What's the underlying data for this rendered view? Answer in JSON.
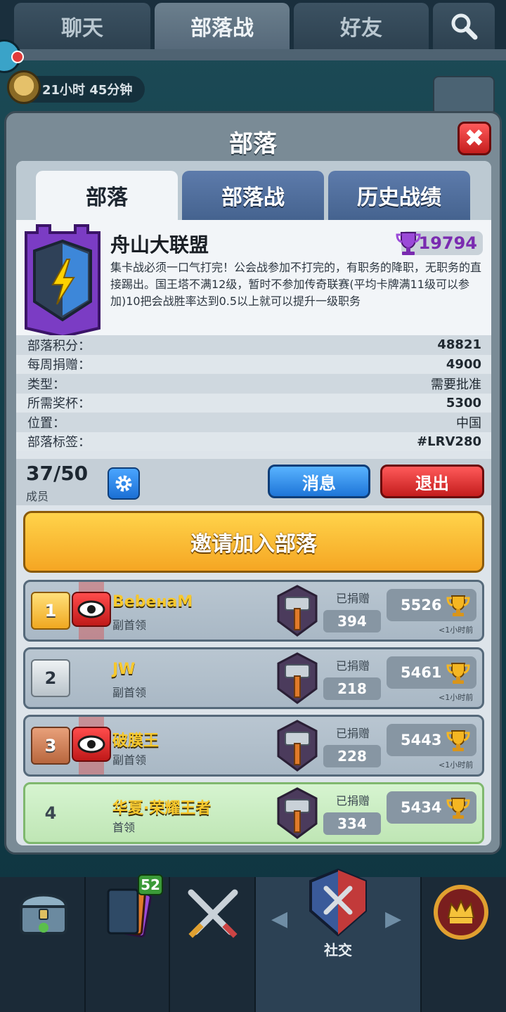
{
  "top_tabs": [
    "聊天",
    "部落战",
    "好友"
  ],
  "timer": {
    "text": "21小时 45分钟"
  },
  "panel": {
    "title": "部落",
    "close_label": "✖"
  },
  "sub_tabs": [
    "部落",
    "部落战",
    "历史战绩"
  ],
  "clan": {
    "name": "舟山大联盟",
    "trophies": "19794",
    "description": "集卡战必须一口气打完！公会战参加不打完的，有职务的降职，无职务的直接踢出。国王塔不满12级，暂时不参加传奇联赛(平均卡牌满11级可以参加)10把会战胜率达到0.5以上就可以提升一级职务"
  },
  "stats": [
    {
      "label": "部落积分：",
      "value": "48821"
    },
    {
      "label": "每周捐赠：",
      "value": "4900"
    },
    {
      "label": "类型：",
      "value": "需要批准"
    },
    {
      "label": "所需奖杯：",
      "value": "5300"
    },
    {
      "label": "位置：",
      "value": "中国"
    },
    {
      "label": "部落标签：",
      "value": "#LRV280"
    }
  ],
  "members_header": {
    "count": "37/50",
    "label": "成员",
    "message_button": "消息",
    "leave_button": "退出",
    "invite_button": "邀请加入部落"
  },
  "donated_label": "已捐赠",
  "members": [
    {
      "rank": "1",
      "name": "BebeнaM",
      "role": "副首领",
      "donated": "394",
      "trophies": "5526",
      "last_seen": "<1小时前"
    },
    {
      "rank": "2",
      "name": "JW",
      "role": "副首领",
      "donated": "218",
      "trophies": "5461",
      "last_seen": "<1小时前"
    },
    {
      "rank": "3",
      "name": "破膜王",
      "role": "副首领",
      "donated": "228",
      "trophies": "5443",
      "last_seen": "<1小时前"
    },
    {
      "rank": "4",
      "name": "华夏·荣耀王者",
      "role": "首领",
      "donated": "334",
      "trophies": "5434",
      "last_seen": ""
    }
  ],
  "bottom_nav": {
    "social_label": "社交",
    "card_badge": "52"
  },
  "colors": {
    "accent_gold": "#f5a623",
    "blue_button": "#1e75d8",
    "red_button": "#c41d1d",
    "name_gold": "#f7c82d"
  }
}
